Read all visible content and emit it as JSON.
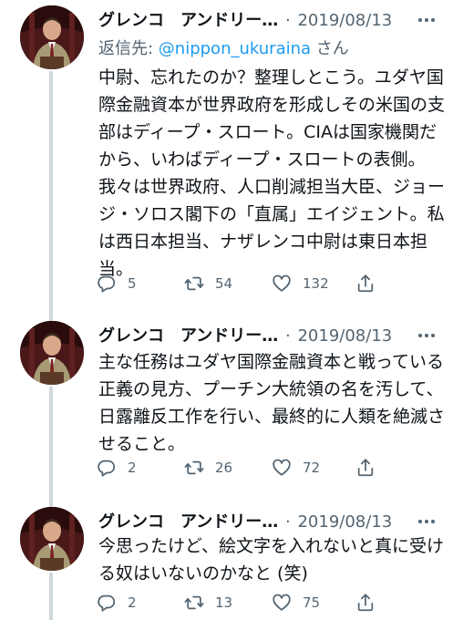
{
  "tweets": [
    {
      "author": "グレンコ　アンドリー…",
      "date": "2019/08/13",
      "reply_prefix": "返信先: ",
      "reply_handle": "@nippon_ukuraina",
      "reply_suffix": " さん",
      "text": "中尉、忘れたのか？整理しとこう。ユダヤ国際金融資本が世界政府を形成しその米国の支部はディープ・スロート。CIAは国家機関だから、いわばディープ・スロートの表側。我々は世界政府、人口削減担当大臣、ジョージ・ソロス閣下の「直属」エイジェント。私は西日本担当、ナザレンコ中尉は東日本担当。",
      "replies": "5",
      "retweets": "54",
      "likes": "132"
    },
    {
      "author": "グレンコ　アンドリー…",
      "date": "2019/08/13",
      "text": "主な任務はユダヤ国際金融資本と戦っている正義の見方、プーチン大統領の名を汚して、日露離反工作を行い、最終的に人類を絶滅させること。",
      "replies": "2",
      "retweets": "26",
      "likes": "72"
    },
    {
      "author": "グレンコ　アンドリー…",
      "date": "2019/08/13",
      "text": "今思ったけど、絵文字を入れないと真に受ける奴はいないのかなと (笑)",
      "replies": "2",
      "retweets": "13",
      "likes": "75"
    }
  ],
  "icons": {
    "more": "more-icon",
    "reply": "reply-icon",
    "retweet": "retweet-icon",
    "like": "like-icon",
    "share": "share-icon"
  },
  "colors": {
    "text": "#0f1419",
    "secondary": "#536471",
    "link": "#1d9bf0",
    "thread_line": "#cfd9de"
  }
}
